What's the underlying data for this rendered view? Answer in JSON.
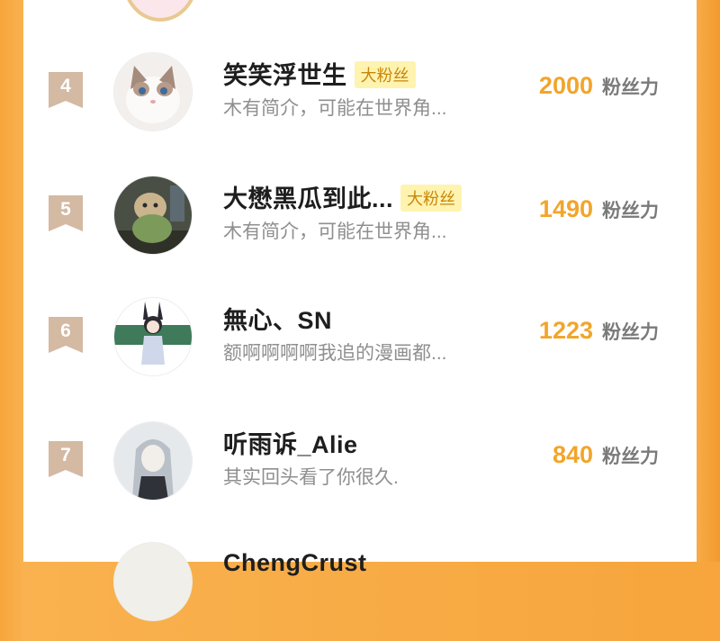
{
  "colors": {
    "accent": "#f7a53c",
    "fans_number": "#f2a52b",
    "tag_bg": "#fff3b0",
    "tag_text": "#c8860a",
    "rank_badge": "#d4b9a3"
  },
  "fans_suffix": "粉丝力",
  "ranking": [
    {
      "rank": "4",
      "name": "笑笑浮世生",
      "tag": "大粉丝",
      "bio": "木有简介，可能在世界角...",
      "fans": "2000",
      "avatar_icon": "cat-avatar-icon"
    },
    {
      "rank": "5",
      "name": "大懋黑瓜到此...",
      "tag": "大粉丝",
      "bio": "木有简介，可能在世界角...",
      "fans": "1490",
      "avatar_icon": "plush-toy-avatar-icon"
    },
    {
      "rank": "6",
      "name": "無心、SN",
      "tag": "",
      "bio": "额啊啊啊啊我追的漫画都...",
      "fans": "1223",
      "avatar_icon": "bunny-girl-avatar-icon"
    },
    {
      "rank": "7",
      "name": "听雨诉_Alie",
      "tag": "",
      "bio": "其实回头看了你很久.",
      "fans": "840",
      "avatar_icon": "anime-girl-avatar-icon"
    },
    {
      "rank": "",
      "name": "ChengCrust",
      "tag": "",
      "bio": "",
      "fans": "",
      "avatar_icon": "partial-avatar-icon"
    }
  ]
}
